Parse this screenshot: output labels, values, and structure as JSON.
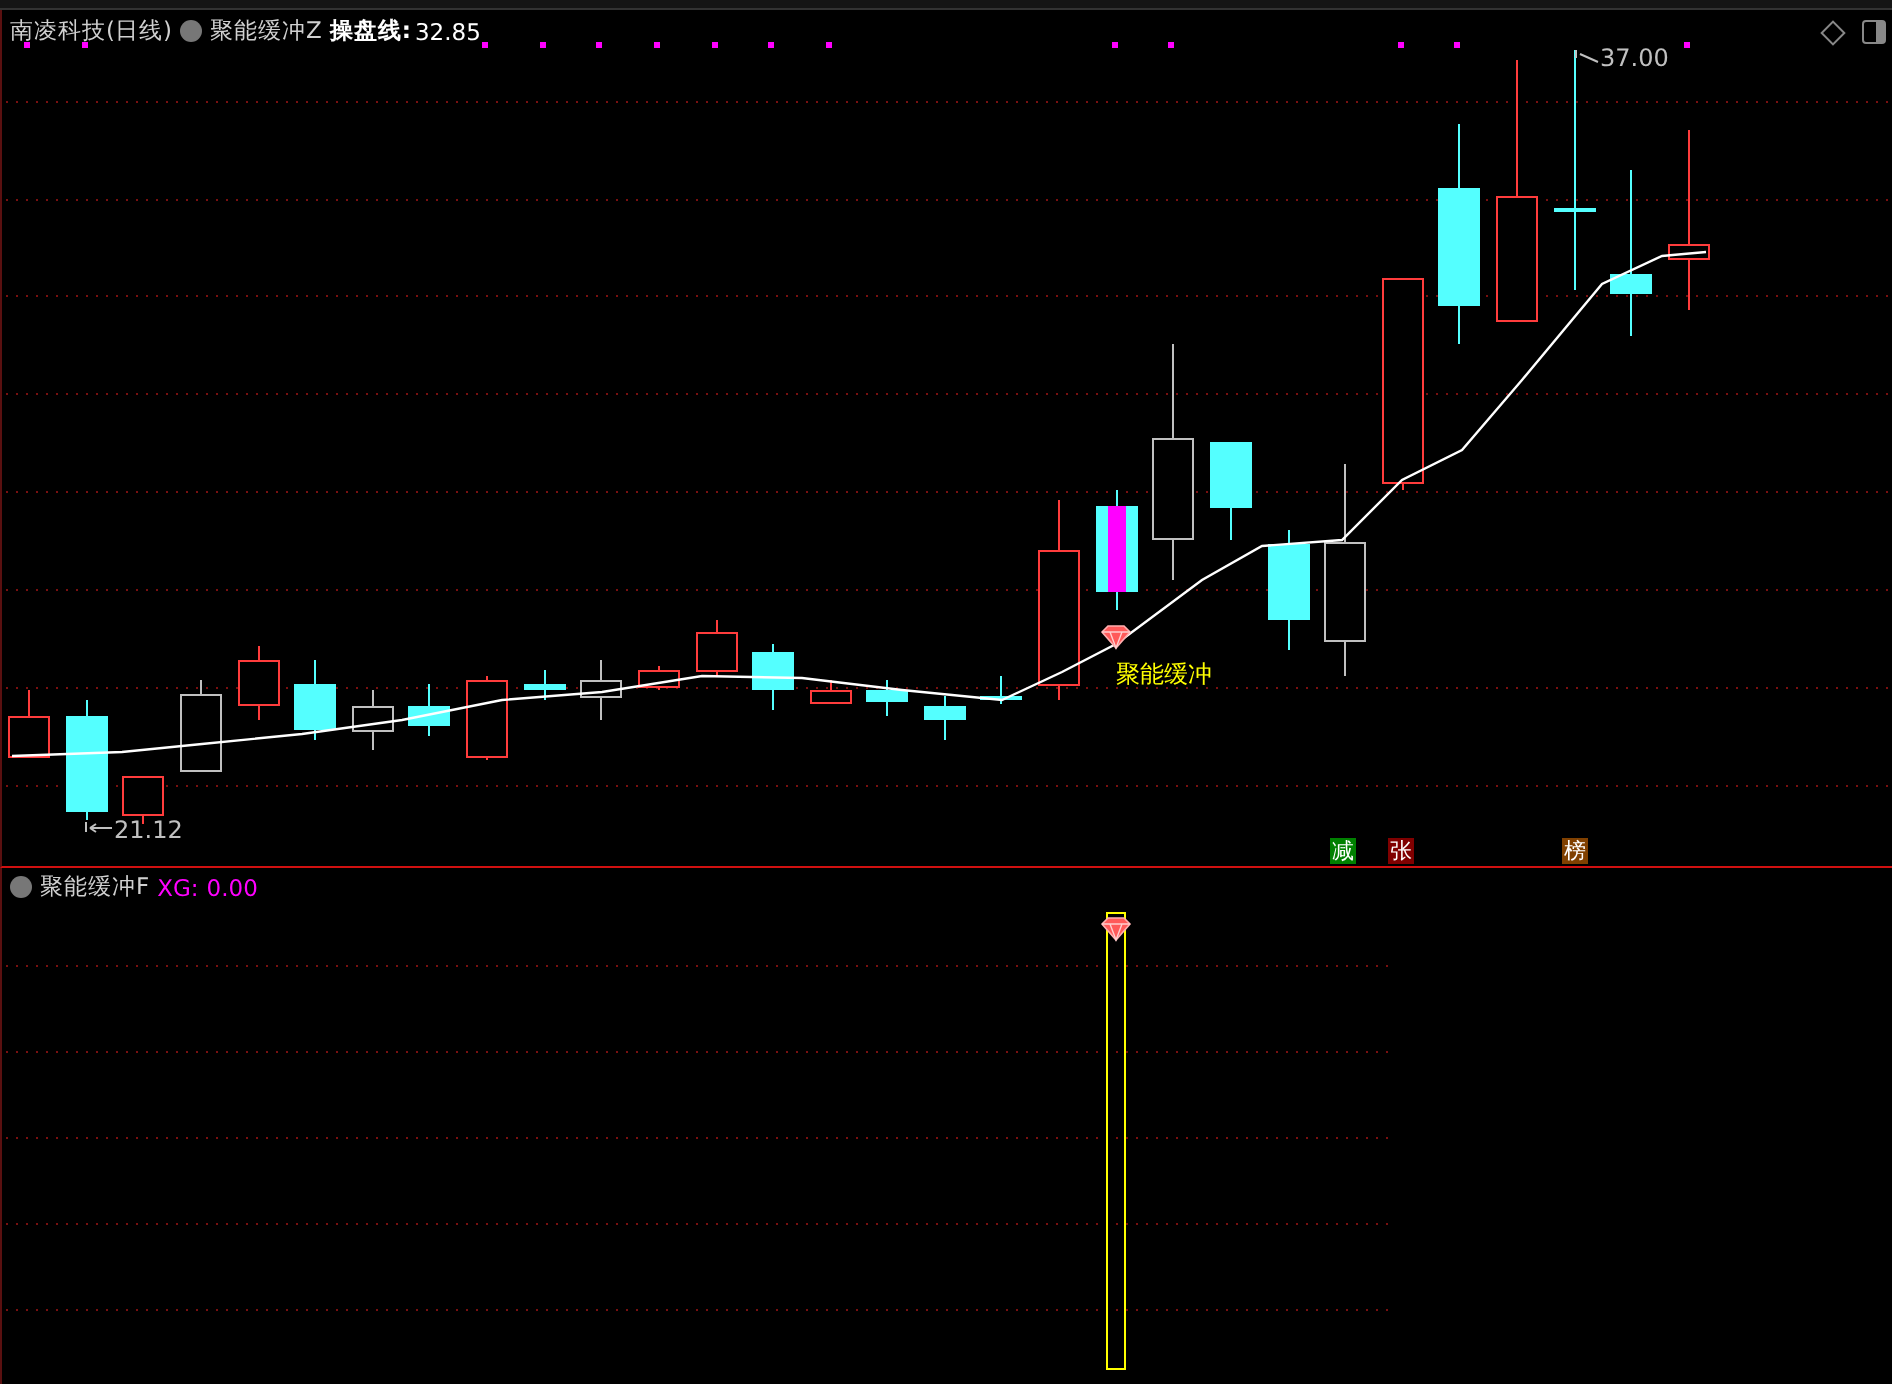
{
  "main_panel": {
    "stock_title": "南凌科技(日线)",
    "indicator_name": "聚能缓冲Z",
    "line_label": "操盘线:",
    "line_value": "32.85",
    "low_label": "21.12",
    "high_label": "37.00",
    "signal_label": "聚能缓冲",
    "badges": [
      {
        "text": "减",
        "color": "#008000"
      },
      {
        "text": "张",
        "color": "#800000"
      },
      {
        "text": "榜",
        "color": "#804000"
      }
    ]
  },
  "sub_panel": {
    "indicator_name": "聚能缓冲F",
    "series_label": "XG:",
    "series_value": "0.00"
  }
}
